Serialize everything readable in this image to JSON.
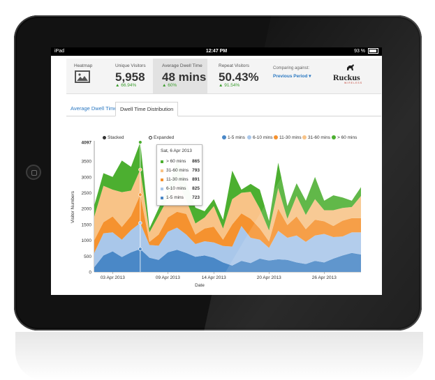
{
  "status_bar": {
    "device": "iPad",
    "time": "12:47 PM",
    "battery": "93 %"
  },
  "header": {
    "heatmap_label": "Heatmap",
    "tiles": [
      {
        "title": "Unique Visitors",
        "value": "5,958",
        "change": "▲ 66.94%"
      },
      {
        "title": "Average Dwell Time",
        "value": "48 mins",
        "change": "▲ 60%"
      },
      {
        "title": "Repeat Visitors",
        "value": "50.43%",
        "change": "▲ 91.54%"
      }
    ],
    "comparing_label": "Comparing against:",
    "comparing_value": "Previous Period ▾",
    "logo": "Ruckus",
    "logo_sub": "WIRELESS"
  },
  "tabs": {
    "average_dwell": "Average Dwell Time",
    "distribution": "Dwell Time Distribution"
  },
  "modes": {
    "stacked": "Stacked",
    "expanded": "Expanded",
    "selected": "stacked"
  },
  "tooltip": {
    "date": "Sat, 6 Apr 2013",
    "rows": [
      {
        "label": "> 60 mins",
        "value": "865"
      },
      {
        "label": "31-60 mins",
        "value": "793"
      },
      {
        "label": "11-30 mins",
        "value": "891"
      },
      {
        "label": "6-10 mins",
        "value": "825"
      },
      {
        "label": "1-5 mins",
        "value": "723"
      }
    ]
  },
  "chart_data": {
    "type": "area",
    "stacked": true,
    "xlabel": "Date",
    "ylabel": "Visitor Numbers",
    "ylim": [
      0,
      4097
    ],
    "yticks": [
      "0",
      "500",
      "1000",
      "1500",
      "2000",
      "2500",
      "3000",
      "3500",
      "4097"
    ],
    "x_tick_labels": [
      {
        "label": "03 Apr 2013",
        "index": 2
      },
      {
        "label": "09 Apr 2013",
        "index": 8
      },
      {
        "label": "14 Apr 2013",
        "index": 13
      },
      {
        "label": "20 Apr 2013",
        "index": 19
      },
      {
        "label": "26 Apr 2013",
        "index": 25
      }
    ],
    "n_points": 30,
    "highlight_index": 5,
    "legend_position": "top-right",
    "series": [
      {
        "name": "1-5 mins",
        "color": "#4a88c7",
        "values": [
          150,
          520,
          650,
          470,
          620,
          723,
          450,
          380,
          620,
          700,
          600,
          480,
          520,
          450,
          300,
          200,
          350,
          280,
          420,
          360,
          400,
          380,
          300,
          250,
          350,
          300,
          420,
          520,
          600,
          550
        ]
      },
      {
        "name": "6-10 mins",
        "color": "#a9c7ea",
        "values": [
          450,
          700,
          600,
          550,
          700,
          825,
          400,
          450,
          650,
          700,
          580,
          400,
          450,
          480,
          520,
          600,
          1100,
          800,
          600,
          400,
          900,
          700,
          850,
          700,
          800,
          900,
          680,
          600,
          650,
          700
        ]
      },
      {
        "name": "11-30 mins",
        "color": "#f5922f",
        "values": [
          400,
          350,
          500,
          400,
          450,
          891,
          100,
          350,
          450,
          500,
          650,
          300,
          400,
          500,
          200,
          700,
          400,
          600,
          350,
          200,
          700,
          400,
          600,
          400,
          500,
          400,
          350,
          500,
          450,
          450
        ]
      },
      {
        "name": "31-60 mins",
        "color": "#f8c387",
        "values": [
          750,
          1150,
          850,
          1100,
          800,
          793,
          300,
          600,
          600,
          1000,
          450,
          350,
          350,
          650,
          350,
          800,
          650,
          850,
          630,
          350,
          650,
          200,
          650,
          450,
          650,
          350,
          500,
          400,
          350,
          700
        ]
      },
      {
        "name": "> 60 mins",
        "color": "#4caf30",
        "values": [
          350,
          400,
          400,
          1000,
          750,
          865,
          130,
          230,
          320,
          650,
          550,
          500,
          200,
          220,
          280,
          900,
          100,
          250,
          600,
          300,
          800,
          400,
          400,
          450,
          700,
          300,
          470,
          330,
          200,
          280
        ]
      }
    ]
  }
}
